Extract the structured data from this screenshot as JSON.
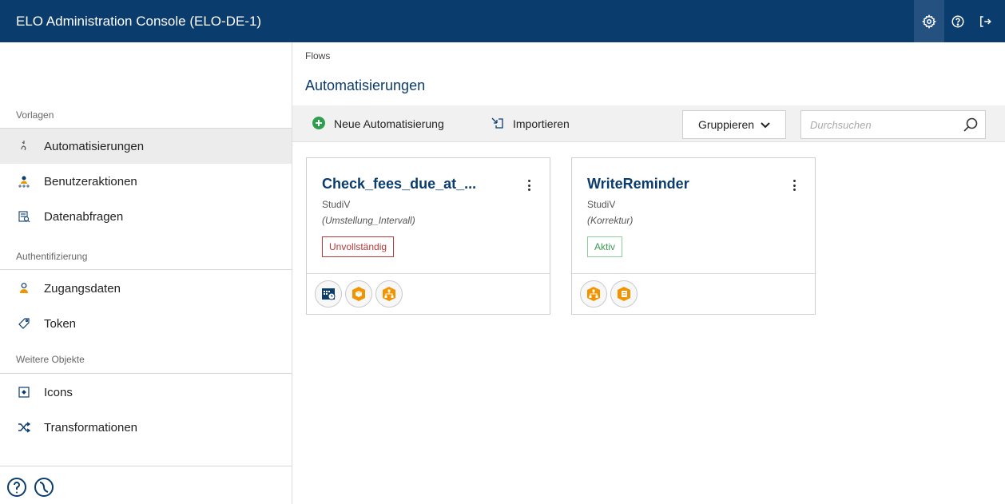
{
  "app": {
    "title": "ELO Administration Console (ELO-DE-1)"
  },
  "topbar": {
    "icons": [
      "gear-icon",
      "help-icon",
      "logout-icon"
    ]
  },
  "sidebar": {
    "sections": [
      {
        "label": "Vorlagen"
      },
      {
        "label": "Authentifizierung"
      },
      {
        "label": "Weitere Objekte"
      }
    ],
    "items": [
      {
        "label": "Automatisierungen",
        "icon": "automation-icon",
        "active": true
      },
      {
        "label": "Benutzeraktionen",
        "icon": "user-actions-icon"
      },
      {
        "label": "Datenabfragen",
        "icon": "data-query-icon"
      },
      {
        "label": "Zugangsdaten",
        "icon": "credentials-icon"
      },
      {
        "label": "Token",
        "icon": "token-icon"
      },
      {
        "label": "Icons",
        "icon": "icons-icon"
      },
      {
        "label": "Transformationen",
        "icon": "shuffle-icon"
      }
    ]
  },
  "breadcrumb": "Flows",
  "page": {
    "title": "Automatisierungen"
  },
  "toolbar": {
    "new_label": "Neue Automatisierung",
    "import_label": "Importieren",
    "group_label": "Gruppieren"
  },
  "search": {
    "placeholder": "Durchsuchen"
  },
  "cards": [
    {
      "title": "Check_fees_due_at_...",
      "subtitle": "StudiV",
      "detail": "(Umstellung_Intervall)",
      "status": "Unvollständig",
      "status_color": "#b3393a",
      "triggers": [
        "schedule-icon",
        "cube-icon",
        "hierarchy-icon"
      ]
    },
    {
      "title": "WriteReminder",
      "subtitle": "StudiV",
      "detail": "(Korrektur)",
      "status": "Aktiv",
      "status_color": "#3c9b55",
      "triggers": [
        "hierarchy-icon",
        "form-icon"
      ]
    }
  ],
  "colors": {
    "header": "#0b3c6e",
    "accent_orange": "#f29400",
    "add_green": "#2e9e4f"
  }
}
